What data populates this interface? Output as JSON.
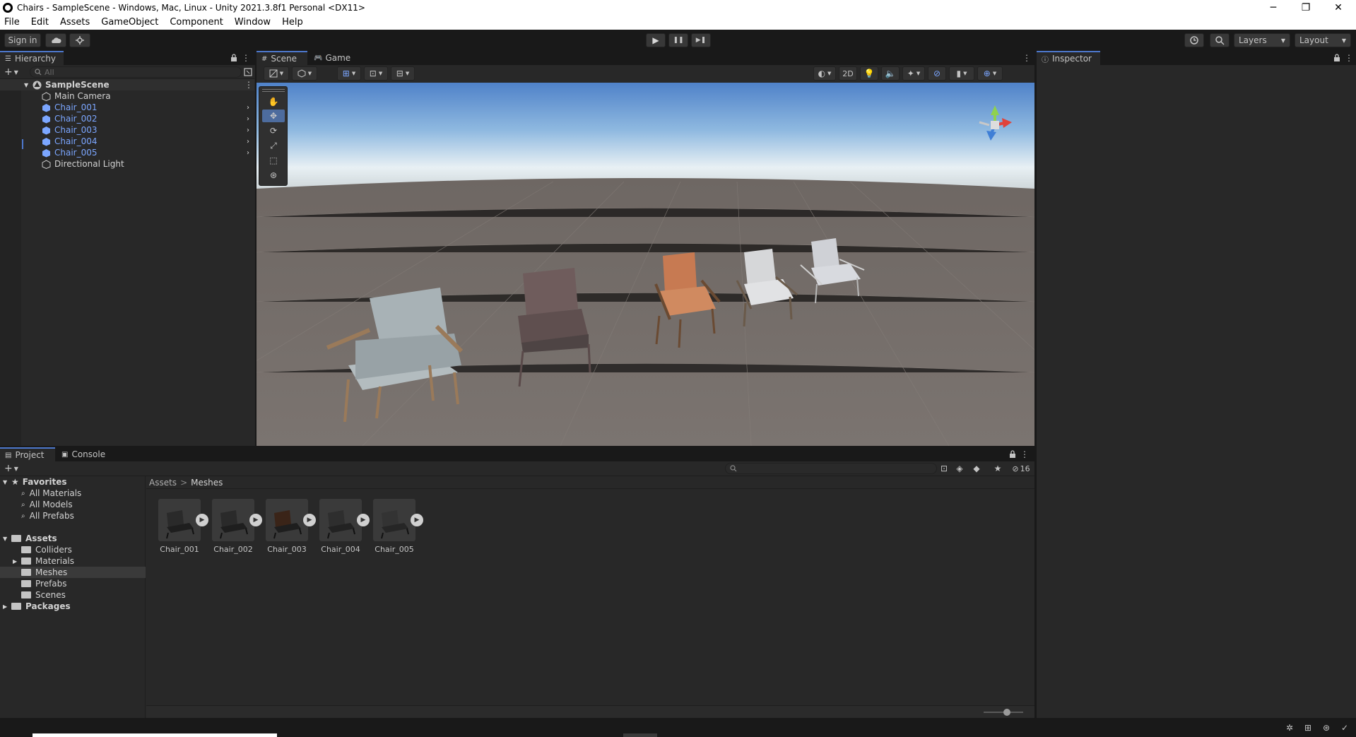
{
  "window": {
    "title": "Chairs - SampleScene - Windows, Mac, Linux - Unity 2021.3.8f1 Personal <DX11>",
    "min_glyph": "─",
    "max_glyph": "❐",
    "close_glyph": "✕"
  },
  "menu": [
    "File",
    "Edit",
    "Assets",
    "GameObject",
    "Component",
    "Window",
    "Help"
  ],
  "toolbar": {
    "sign_in": "Sign in",
    "layers": "Layers",
    "layout": "Layout",
    "play": "▶",
    "pause": "❚❚",
    "step": "▶❚"
  },
  "hierarchy": {
    "tab": "Hierarchy",
    "search_placeholder": "All",
    "scene": "SampleScene",
    "items": [
      {
        "label": "Main Camera",
        "prefab": false
      },
      {
        "label": "Chair_001",
        "prefab": true
      },
      {
        "label": "Chair_002",
        "prefab": true
      },
      {
        "label": "Chair_003",
        "prefab": true
      },
      {
        "label": "Chair_004",
        "prefab": true
      },
      {
        "label": "Chair_005",
        "prefab": true
      },
      {
        "label": "Directional Light",
        "prefab": false
      }
    ]
  },
  "scene": {
    "tab_scene": "Scene",
    "tab_game": "Game",
    "btn_2d": "2D"
  },
  "inspector": {
    "tab": "Inspector"
  },
  "project": {
    "tab_project": "Project",
    "tab_console": "Console",
    "favorites": "Favorites",
    "fav_items": [
      "All Materials",
      "All Models",
      "All Prefabs"
    ],
    "assets": "Assets",
    "asset_folders": [
      "Colliders",
      "Materials",
      "Meshes",
      "Prefabs",
      "Scenes"
    ],
    "packages": "Packages",
    "breadcrumb_root": "Assets",
    "breadcrumb_sep": ">",
    "breadcrumb_current": "Meshes",
    "hidden_count": "16",
    "meshes": [
      "Chair_001",
      "Chair_002",
      "Chair_003",
      "Chair_004",
      "Chair_005"
    ]
  },
  "colors": {
    "accent": "#4d78cc",
    "prefab_blue": "#7ba6ff",
    "panel_bg": "#282828",
    "frame_bg": "#191919"
  }
}
